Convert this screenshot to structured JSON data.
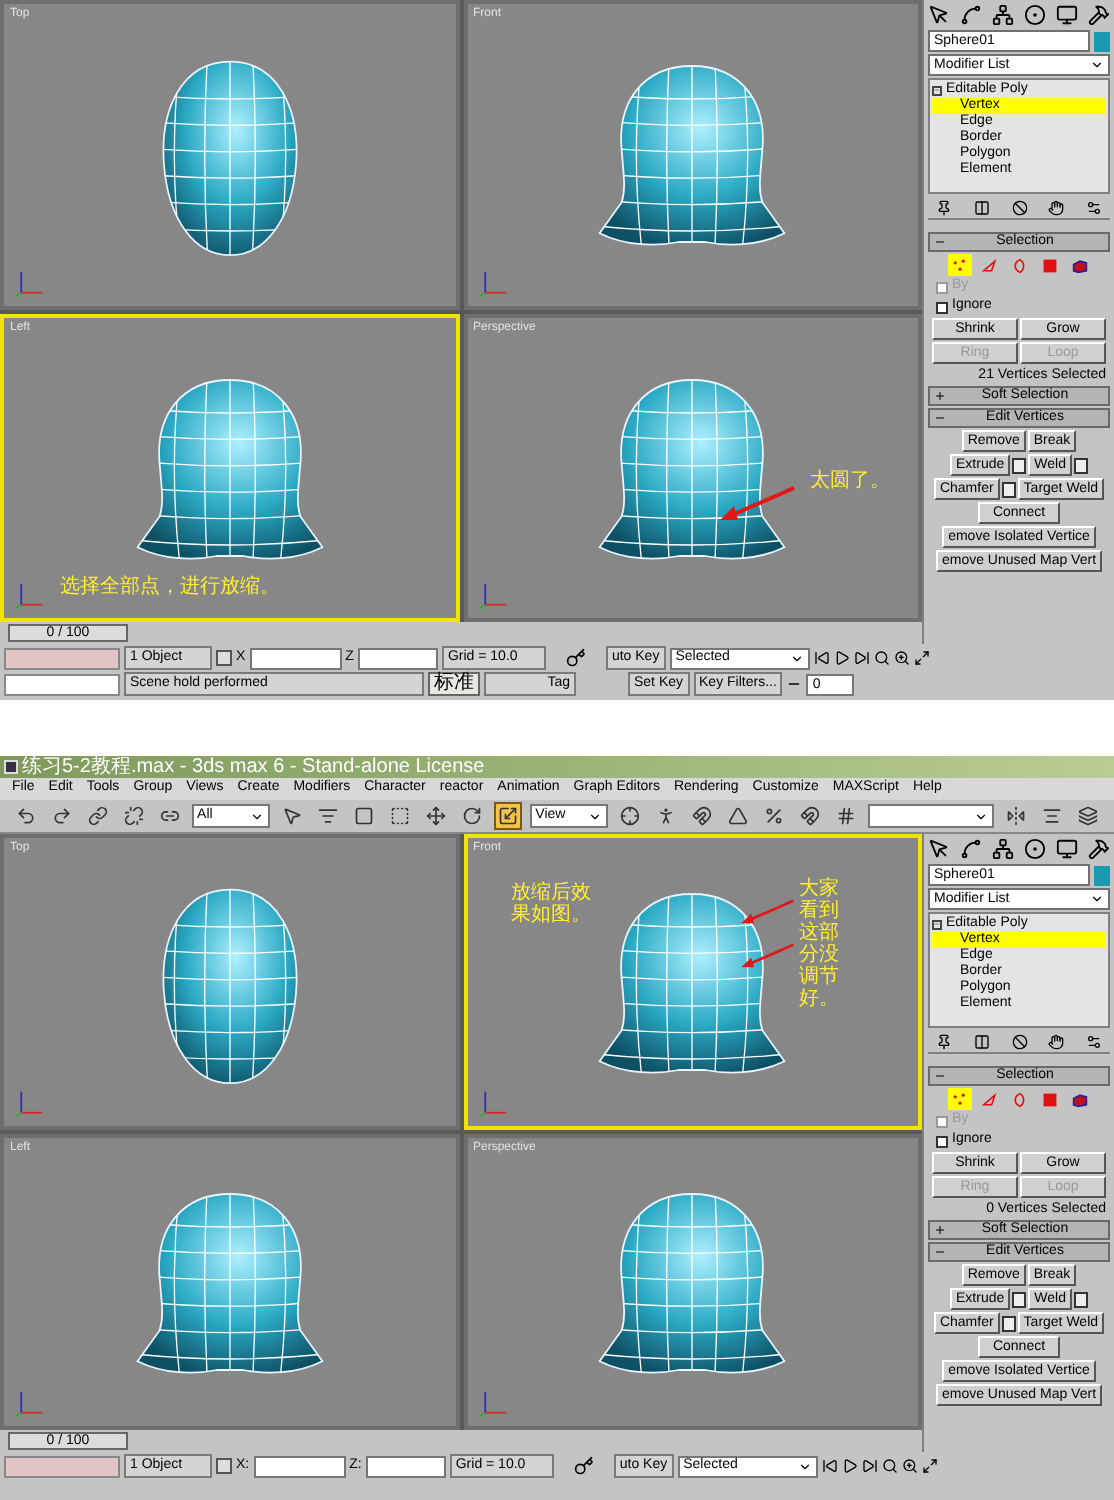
{
  "captures": [
    {
      "viewports": [
        {
          "label": "Top",
          "selected": false
        },
        {
          "label": "Front",
          "selected": false
        },
        {
          "label": "Left",
          "selected": true,
          "notes": [
            {
              "kind": "caption",
              "text": "选择全部点，进行放缩。"
            }
          ]
        },
        {
          "label": "Perspective",
          "selected": false,
          "notes": [
            {
              "kind": "callout",
              "text": "太圆了。"
            }
          ]
        }
      ],
      "time_slider": {
        "text": "0 / 100",
        "level": 0
      },
      "command_panel": {
        "object_name": "Sphere01",
        "modifier_list": "Modifier List",
        "stack": {
          "label": "Editable Poly",
          "expanded": true,
          "children": [
            {
              "label": "Vertex",
              "selected": true
            },
            {
              "label": "Edge",
              "selected": false
            },
            {
              "label": "Border",
              "selected": false
            },
            {
              "label": "Polygon",
              "selected": false
            },
            {
              "label": "Element",
              "selected": false
            }
          ]
        },
        "selection": {
          "title": "Selection",
          "expanded": true,
          "levels": [
            {
              "selected": true
            },
            {
              "selected": false
            },
            {
              "selected": false
            },
            {
              "selected": false
            },
            {
              "selected": false
            }
          ],
          "checks": [
            {
              "label": "By",
              "checked": false,
              "disabled": true
            },
            {
              "label": "Ignore",
              "checked": false,
              "disabled": false
            }
          ],
          "buttons": [
            {
              "label": "Shrink",
              "disabled": false
            },
            {
              "label": "Grow",
              "disabled": false
            },
            {
              "label": "Ring",
              "disabled": true
            },
            {
              "label": "Loop",
              "disabled": true
            }
          ],
          "info": "21 Vertices Selected"
        },
        "soft_selection": {
          "title": "Soft Selection",
          "expanded": false
        },
        "edit_vertices": {
          "title": "Edit Vertices",
          "expanded": true,
          "rows": [
            [
              {
                "label": "Remove",
                "settings": false
              },
              {
                "label": "Break",
                "settings": false
              }
            ],
            [
              {
                "label": "Extrude",
                "settings": true
              },
              {
                "label": "Weld",
                "settings": true
              }
            ],
            [
              {
                "label": "Chamfer",
                "settings": true
              },
              {
                "label": "Target Weld",
                "settings": false
              }
            ],
            [
              {
                "label": "Connect",
                "settings": false
              }
            ],
            [
              {
                "label": "emove Isolated Vertice",
                "settings": false
              }
            ],
            [
              {
                "label": "emove Unused Map Vert",
                "settings": false
              }
            ]
          ]
        }
      },
      "status_bar": {
        "object_count": "1 Object",
        "x_label": "X",
        "z_label": "Z",
        "grid": "Grid = 10.0",
        "auto_key": "uto Key",
        "key_mode": "Selected",
        "frame": "0",
        "prompt": "Scene hold performed",
        "ime": "标准",
        "time_tag": "Tag",
        "set_key": "Set Key",
        "key_filters": "Key Filters..."
      }
    },
    {
      "window": {
        "title": "练习5-2教程.max - 3ds max 6 - Stand-alone License"
      },
      "menu": [
        "File",
        "Edit",
        "Tools",
        "Group",
        "Views",
        "Create",
        "Modifiers",
        "Character",
        "reactor",
        "Animation",
        "Graph Editors",
        "Rendering",
        "Customize",
        "MAXScript",
        "Help"
      ],
      "toolbar": [
        {
          "kind": "icon",
          "selected": false
        },
        {
          "kind": "icon",
          "selected": false
        },
        {
          "kind": "icon",
          "selected": false
        },
        {
          "kind": "icon",
          "selected": false
        },
        {
          "kind": "icon",
          "selected": false
        },
        {
          "kind": "dropdown",
          "value": "All"
        },
        {
          "kind": "icon",
          "selected": false
        },
        {
          "kind": "icon",
          "selected": false
        },
        {
          "kind": "icon",
          "selected": false
        },
        {
          "kind": "icon",
          "selected": false
        },
        {
          "kind": "icon",
          "selected": false
        },
        {
          "kind": "icon",
          "selected": false
        },
        {
          "kind": "icon",
          "selected": true
        },
        {
          "kind": "dropdown",
          "value": "View"
        },
        {
          "kind": "icon",
          "selected": false
        },
        {
          "kind": "icon",
          "selected": false
        },
        {
          "kind": "icon",
          "selected": false
        },
        {
          "kind": "icon",
          "selected": false
        },
        {
          "kind": "icon",
          "selected": false
        },
        {
          "kind": "icon",
          "selected": false
        },
        {
          "kind": "icon",
          "selected": false
        },
        {
          "kind": "dropdown"
        },
        {
          "kind": "icon",
          "selected": false
        },
        {
          "kind": "icon",
          "selected": false
        },
        {
          "kind": "icon",
          "selected": false
        }
      ],
      "viewports": [
        {
          "label": "Top",
          "selected": false
        },
        {
          "label": "Front",
          "selected": true,
          "notes": [
            {
              "kind": "label",
              "text": "放缩后效果如图。"
            },
            {
              "kind": "column",
              "text": "大家看到这部分没调节好。"
            }
          ]
        },
        {
          "label": "Left",
          "selected": false
        },
        {
          "label": "Perspective",
          "selected": false
        }
      ],
      "time_slider": {
        "text": "0 / 100",
        "level": 0
      },
      "command_panel": {
        "object_name": "Sphere01",
        "modifier_list": "Modifier List",
        "stack": {
          "label": "Editable Poly",
          "expanded": true,
          "children": [
            {
              "label": "Vertex",
              "selected": true
            },
            {
              "label": "Edge",
              "selected": false
            },
            {
              "label": "Border",
              "selected": false
            },
            {
              "label": "Polygon",
              "selected": false
            },
            {
              "label": "Element",
              "selected": false
            }
          ]
        },
        "selection": {
          "title": "Selection",
          "expanded": true,
          "levels": [
            {
              "selected": true
            },
            {
              "selected": false
            },
            {
              "selected": false
            },
            {
              "selected": false
            },
            {
              "selected": false
            }
          ],
          "checks": [
            {
              "label": "By",
              "checked": false,
              "disabled": true
            },
            {
              "label": "Ignore",
              "checked": false,
              "disabled": false
            }
          ],
          "buttons": [
            {
              "label": "Shrink",
              "disabled": false
            },
            {
              "label": "Grow",
              "disabled": false
            },
            {
              "label": "Ring",
              "disabled": true
            },
            {
              "label": "Loop",
              "disabled": true
            }
          ],
          "info": "0 Vertices Selected"
        },
        "soft_selection": {
          "title": "Soft Selection",
          "expanded": false
        },
        "edit_vertices": {
          "title": "Edit Vertices",
          "expanded": true,
          "rows": [
            [
              {
                "label": "Remove",
                "settings": false
              },
              {
                "label": "Break",
                "settings": false
              }
            ],
            [
              {
                "label": "Extrude",
                "settings": true
              },
              {
                "label": "Weld",
                "settings": true
              }
            ],
            [
              {
                "label": "Chamfer",
                "settings": true
              },
              {
                "label": "Target Weld",
                "settings": false
              }
            ],
            [
              {
                "label": "Connect",
                "settings": false
              }
            ],
            [
              {
                "label": "emove Isolated Vertice",
                "settings": false
              }
            ],
            [
              {
                "label": "emove Unused Map Vert",
                "settings": false
              }
            ]
          ]
        }
      },
      "status_bar": {
        "object_count": "1 Object",
        "x_label": "X:",
        "z_label": "Z:",
        "grid": "Grid = 10.0",
        "auto_key": "uto Key",
        "key_mode": "Selected"
      }
    }
  ]
}
